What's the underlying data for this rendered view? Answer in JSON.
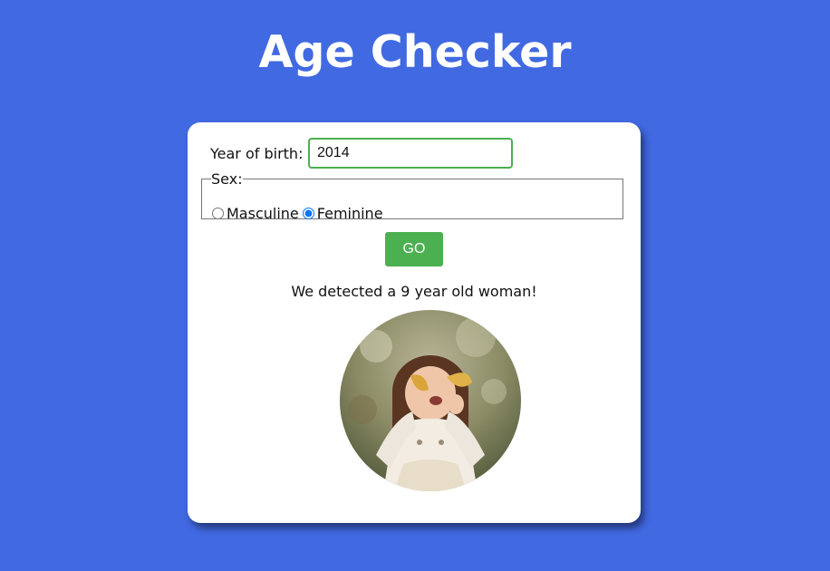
{
  "header": {
    "title": "Age Checker"
  },
  "form": {
    "birth_label": "Year of birth:",
    "birth_value": "2014",
    "sex_legend": "Sex:",
    "sex_options": [
      "Masculine",
      "Feminine"
    ],
    "sex_selected": "Feminine",
    "go_label": "GO"
  },
  "result": {
    "message": "We detected a 9 year old woman!"
  },
  "colors": {
    "background": "#4169e1",
    "accent": "#4caf50",
    "card": "#ffffff"
  }
}
